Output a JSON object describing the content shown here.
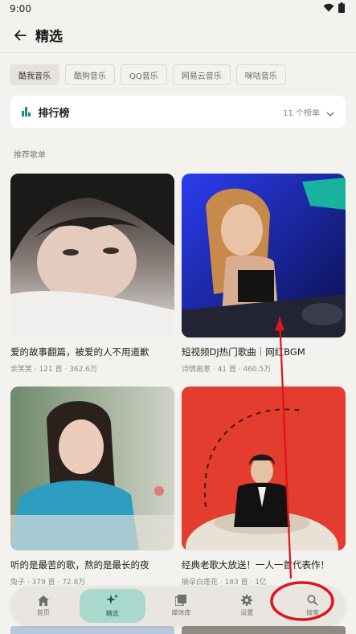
{
  "status_bar": {
    "time": "9:00"
  },
  "header": {
    "title": "精选"
  },
  "source_tabs": [
    {
      "label": "酷我音乐",
      "active": true
    },
    {
      "label": "酷狗音乐",
      "active": false
    },
    {
      "label": "QQ音乐",
      "active": false
    },
    {
      "label": "网易云音乐",
      "active": false
    },
    {
      "label": "咪咕音乐",
      "active": false
    }
  ],
  "ranking": {
    "title": "排行榜",
    "count": "11 个榜单"
  },
  "recommend": {
    "section_title": "推荐歌单",
    "playlists": [
      {
        "title": "爱的故事翻篇，被爱的人不用道歉",
        "meta": "余笑笑 · 121 首 · 362.6万"
      },
      {
        "title": "短视频DJ热门歌曲｜网红BGM",
        "meta": "诗情画意 · 41 首 · 460.5万"
      },
      {
        "title": "听的是最苦的歌，熬的是最长的夜",
        "meta": "兔子 · 379 首 · 72.8万"
      },
      {
        "title": "经典老歌大放送！一人一首代表作！",
        "meta": "摘朵白莲花 · 183 首 · 1亿"
      }
    ]
  },
  "bottom_nav": [
    {
      "label": "首页",
      "icon": "home-icon",
      "active": false
    },
    {
      "label": "精选",
      "icon": "sparkle-icon",
      "active": true
    },
    {
      "label": "媒体库",
      "icon": "library-icon",
      "active": false
    },
    {
      "label": "设置",
      "icon": "gear-icon",
      "active": false
    },
    {
      "label": "搜索",
      "icon": "search-icon",
      "active": false
    }
  ],
  "colors": {
    "accent": "#1e8a7c",
    "active_tab_bg": "#a9d9cc",
    "annotation": "#e0141e"
  }
}
